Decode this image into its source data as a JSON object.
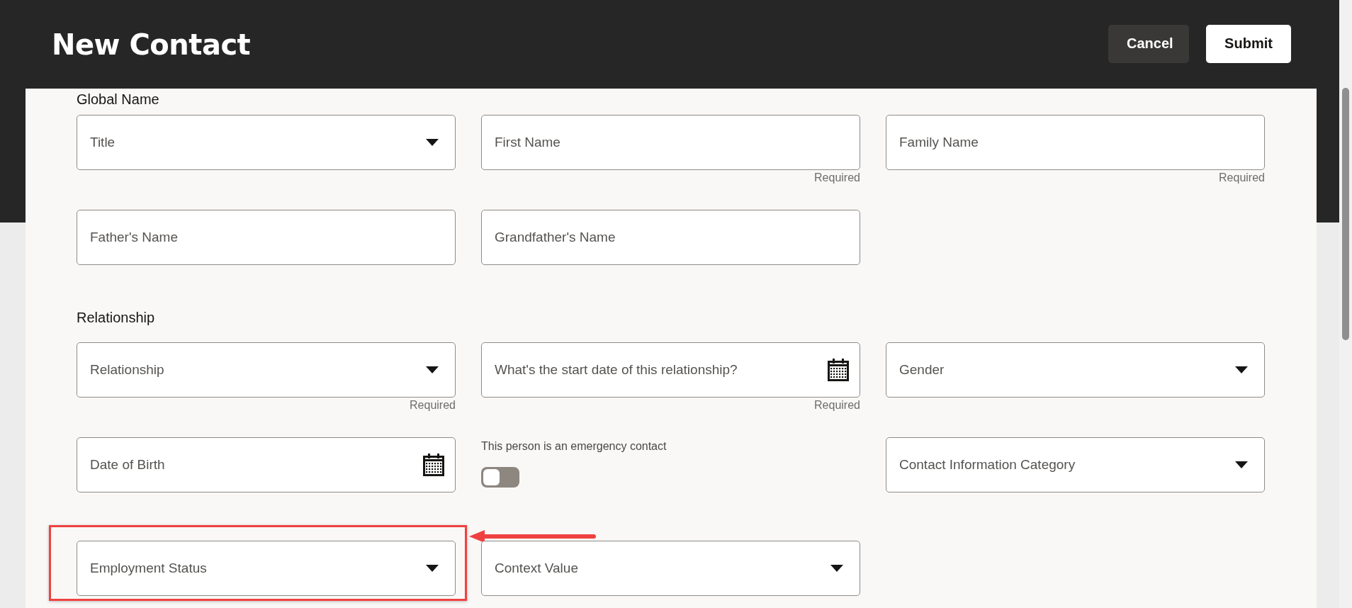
{
  "title": "New Contact",
  "actions": [
    {
      "label": "Cancel",
      "kind": "secondary"
    },
    {
      "label": "Submit",
      "kind": "primary"
    }
  ],
  "sections": [
    {
      "title": "Global Name",
      "rows": [
        [
          {
            "kind": "select",
            "placeholder": "Title"
          },
          {
            "kind": "text",
            "placeholder": "First Name",
            "helper": "Required"
          },
          {
            "kind": "text",
            "placeholder": "Family Name",
            "helper": "Required"
          }
        ],
        [
          {
            "kind": "text",
            "placeholder": "Father's Name"
          },
          {
            "kind": "text",
            "placeholder": "Grandfather's Name"
          }
        ]
      ]
    },
    {
      "title": "Relationship",
      "rows": [
        [
          {
            "kind": "select",
            "placeholder": "Relationship",
            "helper": "Required"
          },
          {
            "kind": "date",
            "placeholder": "What's the start date of this relationship?",
            "helper": "Required"
          },
          {
            "kind": "select",
            "placeholder": "Gender"
          }
        ],
        [
          {
            "kind": "date",
            "placeholder": "Date of Birth"
          },
          {
            "kind": "toggle",
            "label": "This person is an emergency contact",
            "on": false
          },
          {
            "kind": "select",
            "placeholder": "Contact Information Category"
          }
        ],
        [
          {
            "kind": "select",
            "placeholder": "Employment Status",
            "highlighted": true
          },
          {
            "kind": "select",
            "placeholder": "Context Value"
          }
        ]
      ]
    }
  ]
}
